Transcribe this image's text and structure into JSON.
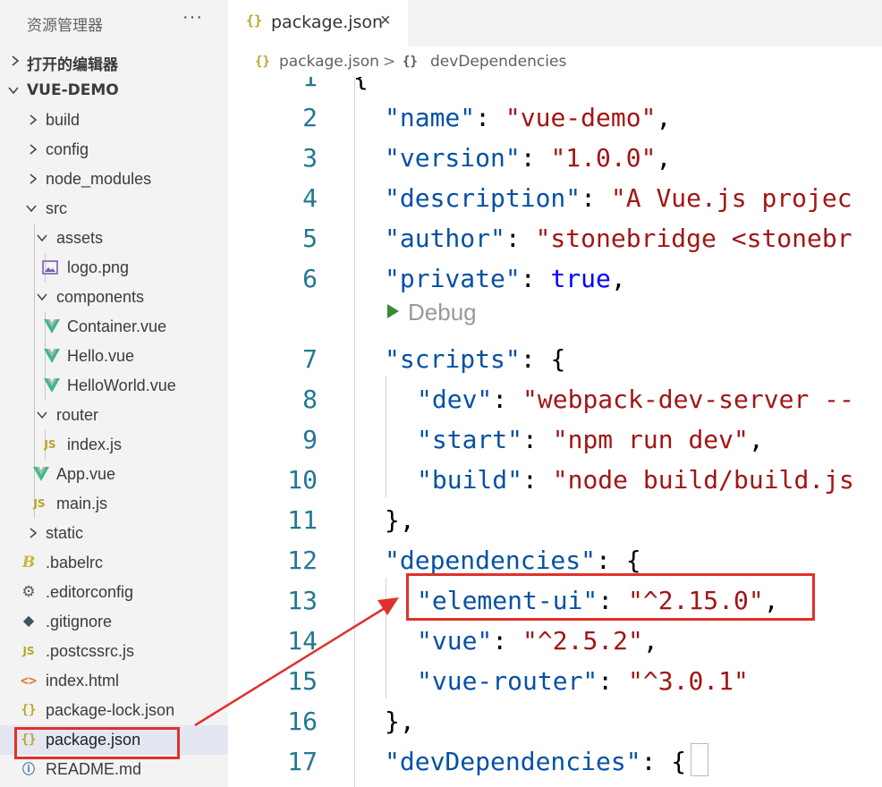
{
  "explorer": {
    "title": "资源管理器",
    "more": "···",
    "open_editors": "打开的编辑器",
    "project": "VUE-DEMO",
    "items": [
      {
        "label": "build",
        "type": "folder"
      },
      {
        "label": "config",
        "type": "folder"
      },
      {
        "label": "node_modules",
        "type": "folder"
      },
      {
        "label": "src",
        "type": "folder-open"
      },
      {
        "label": "assets",
        "type": "folder-open"
      },
      {
        "label": "logo.png",
        "type": "image"
      },
      {
        "label": "components",
        "type": "folder-open"
      },
      {
        "label": "Container.vue",
        "type": "vue"
      },
      {
        "label": "Hello.vue",
        "type": "vue"
      },
      {
        "label": "HelloWorld.vue",
        "type": "vue"
      },
      {
        "label": "router",
        "type": "folder-open"
      },
      {
        "label": "index.js",
        "type": "js"
      },
      {
        "label": "App.vue",
        "type": "vue"
      },
      {
        "label": "main.js",
        "type": "js"
      },
      {
        "label": "static",
        "type": "folder"
      },
      {
        "label": ".babelrc",
        "type": "babel"
      },
      {
        "label": ".editorconfig",
        "type": "gear"
      },
      {
        "label": ".gitignore",
        "type": "git"
      },
      {
        "label": ".postcssrc.js",
        "type": "js"
      },
      {
        "label": "index.html",
        "type": "html"
      },
      {
        "label": "package-lock.json",
        "type": "json"
      },
      {
        "label": "package.json",
        "type": "json"
      },
      {
        "label": "README.md",
        "type": "info"
      }
    ]
  },
  "icons": {
    "json": "{}",
    "js": "JS",
    "html": "<>",
    "info": "ⓘ",
    "gear": "⚙",
    "git": "◆",
    "babel": "B"
  },
  "tab": {
    "icon": "{}",
    "label": "package.json",
    "close": "×"
  },
  "breadcrumb": {
    "file_icon": "{}",
    "file": "package.json",
    "separator": ">",
    "node_icon": "{}",
    "node": "devDependencies"
  },
  "editor": {
    "first_line_partial": "{",
    "codelens": "Debug",
    "lines": [
      {
        "n": "2",
        "key": "\"name\"",
        "sep": ": ",
        "val": "\"vue-demo\"",
        "vt": "s",
        "tail": ","
      },
      {
        "n": "3",
        "key": "\"version\"",
        "sep": ": ",
        "val": "\"1.0.0\"",
        "vt": "s",
        "tail": ","
      },
      {
        "n": "4",
        "key": "\"description\"",
        "sep": ": ",
        "val": "\"A Vue.js projec",
        "vt": "s",
        "tail": ""
      },
      {
        "n": "5",
        "key": "\"author\"",
        "sep": ": ",
        "val": "\"stonebridge <stonebr",
        "vt": "s",
        "tail": ""
      },
      {
        "n": "6",
        "key": "\"private\"",
        "sep": ": ",
        "val": "true",
        "vt": "b",
        "tail": ","
      },
      {
        "n": "7",
        "key": "\"scripts\"",
        "sep": ": ",
        "val": "",
        "vt": "s",
        "tail": "{"
      },
      {
        "n": "8",
        "key": "\"dev\"",
        "sep": ": ",
        "val": "\"webpack-dev-server --",
        "vt": "s",
        "tail": ""
      },
      {
        "n": "9",
        "key": "\"start\"",
        "sep": ": ",
        "val": "\"npm run dev\"",
        "vt": "s",
        "tail": ","
      },
      {
        "n": "10",
        "key": "\"build\"",
        "sep": ": ",
        "val": "\"node build/build.js",
        "vt": "s",
        "tail": ""
      },
      {
        "n": "11",
        "key": "",
        "sep": "",
        "val": "",
        "vt": "s",
        "tail": "},"
      },
      {
        "n": "12",
        "key": "\"dependencies\"",
        "sep": ": ",
        "val": "",
        "vt": "s",
        "tail": "{"
      },
      {
        "n": "13",
        "key": "\"element-ui\"",
        "sep": ": ",
        "val": "\"^2.15.0\"",
        "vt": "s",
        "tail": ","
      },
      {
        "n": "14",
        "key": "\"vue\"",
        "sep": ": ",
        "val": "\"^2.5.2\"",
        "vt": "s",
        "tail": ","
      },
      {
        "n": "15",
        "key": "\"vue-router\"",
        "sep": ": ",
        "val": "\"^3.0.1\"",
        "vt": "s",
        "tail": ""
      },
      {
        "n": "16",
        "key": "",
        "sep": "",
        "val": "",
        "vt": "s",
        "tail": "},"
      },
      {
        "n": "17",
        "key": "\"devDependencies\"",
        "sep": ": ",
        "val": "",
        "vt": "s",
        "tail": "{"
      }
    ]
  },
  "colors": {
    "annotation": "#e0312b",
    "sidebar_bg": "#f3f3f3",
    "json_key": "#0451a5",
    "json_string": "#a31515",
    "json_bool": "#0000ff",
    "line_number": "#237893"
  }
}
